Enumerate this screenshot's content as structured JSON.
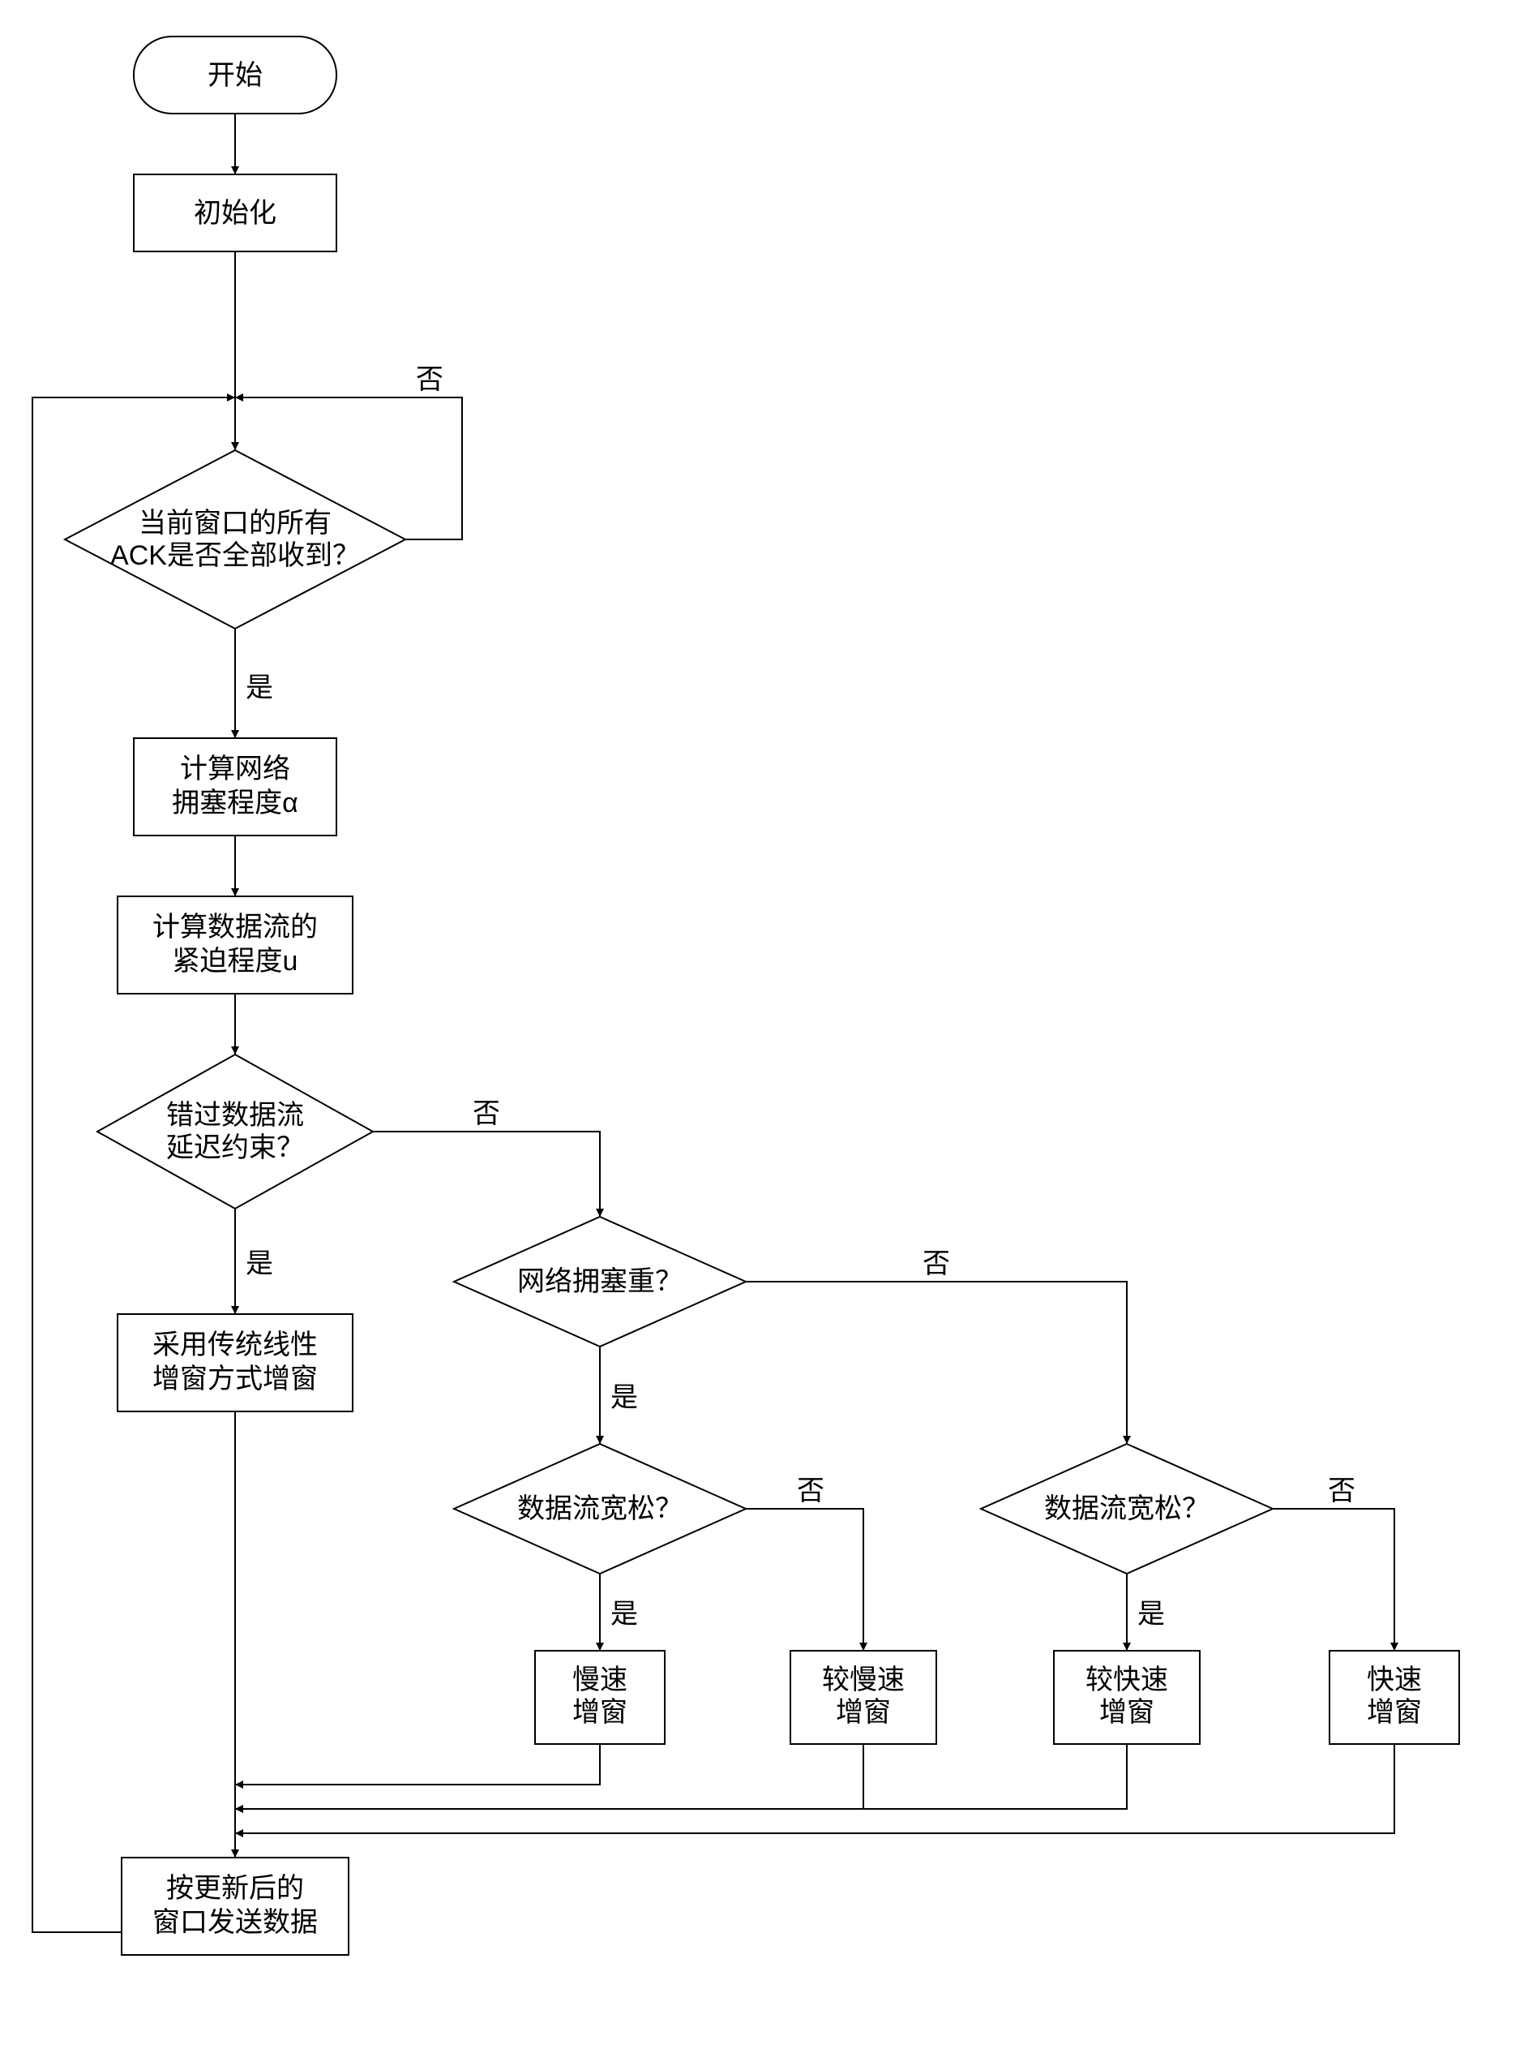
{
  "flow": {
    "start": "开始",
    "init": "初始化",
    "ack_check_l1": "当前窗口的所有",
    "ack_check_l2": "ACK是否全部收到？",
    "calc_alpha_l1": "计算网络",
    "calc_alpha_l2": "拥塞程度α",
    "calc_u_l1": "计算数据流的",
    "calc_u_l2": "紧迫程度u",
    "missed_delay_l1": "错过数据流",
    "missed_delay_l2": "延迟约束？",
    "linear_inc_l1": "采用传统线性",
    "linear_inc_l2": "增窗方式增窗",
    "net_heavy": "网络拥塞重？",
    "flow_loose_left": "数据流宽松？",
    "flow_loose_right": "数据流宽松？",
    "slow_inc_l1": "慢速",
    "slow_inc_l2": "增窗",
    "slower_inc_l1": "较慢速",
    "slower_inc_l2": "增窗",
    "faster_inc_l1": "较快速",
    "faster_inc_l2": "增窗",
    "fast_inc_l1": "快速",
    "fast_inc_l2": "增窗",
    "send_data_l1": "按更新后的",
    "send_data_l2": "窗口发送数据",
    "yes": "是",
    "no": "否"
  }
}
